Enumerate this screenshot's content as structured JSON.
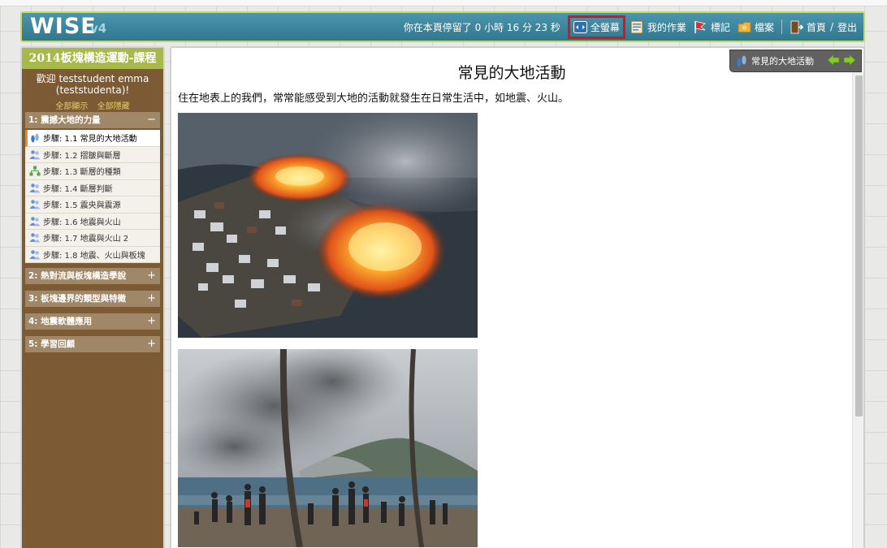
{
  "header": {
    "logo": "WISE",
    "version": "v4",
    "timer": "你在本頁停留了 0 小時 16 分 23 秒",
    "fullscreen": "全螢幕",
    "my_work": "我的作業",
    "flags": "標記",
    "files": "檔案",
    "home": "首頁",
    "slash": "/",
    "logout": "登出"
  },
  "sidebar": {
    "course_title": "2014板塊構造運動-課程",
    "welcome_line1": "歡迎 teststudent emma",
    "welcome_line2": "(teststudenta)!",
    "show_all": "全部顯示",
    "hide_all": "全部隱藏",
    "sections": [
      {
        "label": "1: 震撼大地的力量",
        "toggle": "−"
      },
      {
        "label": "2: 熱對流與板塊構造學說",
        "toggle": "+"
      },
      {
        "label": "3: 板塊邊界的類型與特徵",
        "toggle": "+"
      },
      {
        "label": "4: 地震軟體應用",
        "toggle": "+"
      },
      {
        "label": "5: 學習回顧",
        "toggle": "+"
      }
    ],
    "steps": [
      {
        "label": "步驟: 1.1 常見的大地活動",
        "icon": "footprint-icon",
        "active": true
      },
      {
        "label": "步驟: 1.2 摺皺與斷層",
        "icon": "people-icon"
      },
      {
        "label": "步驟: 1.3 斷層的種類",
        "icon": "hierarchy-icon"
      },
      {
        "label": "步驟: 1.4 斷層判斷",
        "icon": "people-icon"
      },
      {
        "label": "步驟: 1.5 震央與震源",
        "icon": "people-icon"
      },
      {
        "label": "步驟: 1.6 地震與火山",
        "icon": "people-icon"
      },
      {
        "label": "步驟: 1.7 地震與火山 2",
        "icon": "people-icon"
      },
      {
        "label": "步驟: 1.8 地震、火山與板塊",
        "icon": "people-icon"
      }
    ]
  },
  "content": {
    "nav_title": "常見的大地活動",
    "title": "常見的大地活動",
    "intro": "住在地表上的我們，常常能感受到大地的活動就發生在日常生活中，如地震、火山。",
    "images": [
      "burning-town-photo",
      "volcano-eruption-photo"
    ]
  },
  "colors": {
    "header_bg": "#3a869d",
    "header_border": "#c4d960",
    "sidebar_bg": "#7c5a33",
    "course_title_bg": "#a9b84a",
    "section_bg": "#a08768",
    "highlight_red": "#d9141b",
    "active_step_marker": "#e58a32"
  }
}
